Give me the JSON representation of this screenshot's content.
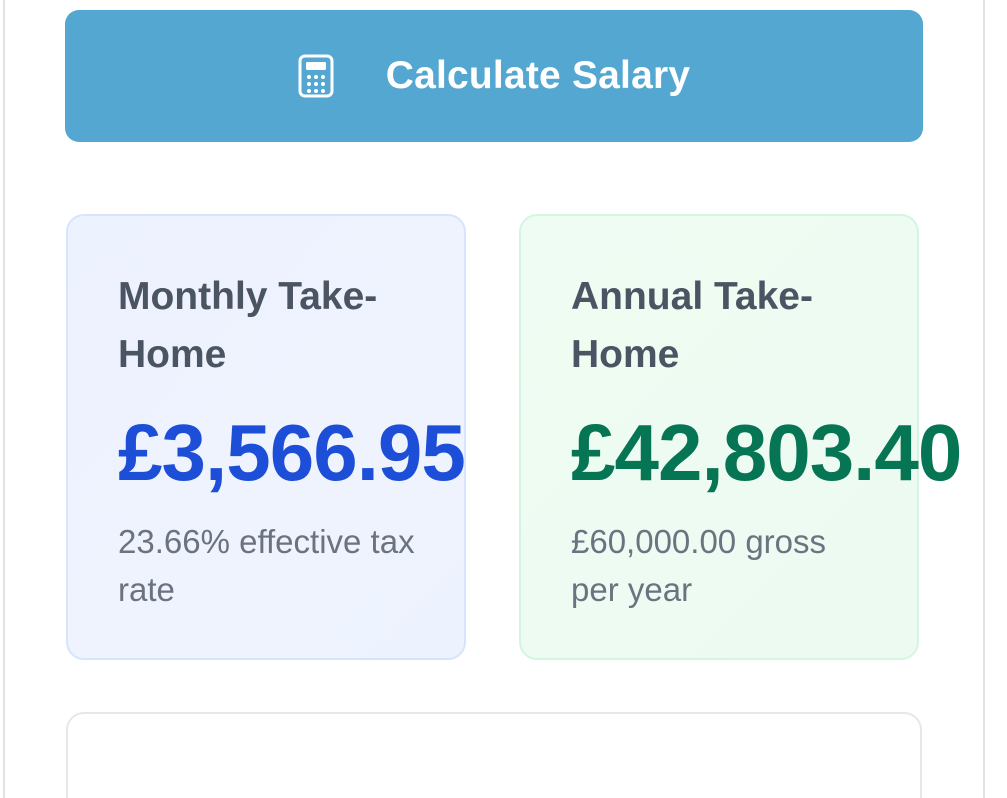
{
  "calculate_button": {
    "label": "Calculate Salary",
    "icon": "calculator-icon"
  },
  "monthly_card": {
    "title": "Monthly Take-Home",
    "amount": "£3,566.95",
    "subtitle": "23.66% effective tax rate",
    "accent_color": "#1c4ed8"
  },
  "annual_card": {
    "title": "Annual Take-Home",
    "amount": "£42,803.40",
    "subtitle": "£60,000.00 gross per year",
    "accent_color": "#067553"
  },
  "colors": {
    "button_bg": "#53a7d0",
    "text_muted": "#6b7280",
    "text_heading": "#4b5462"
  }
}
